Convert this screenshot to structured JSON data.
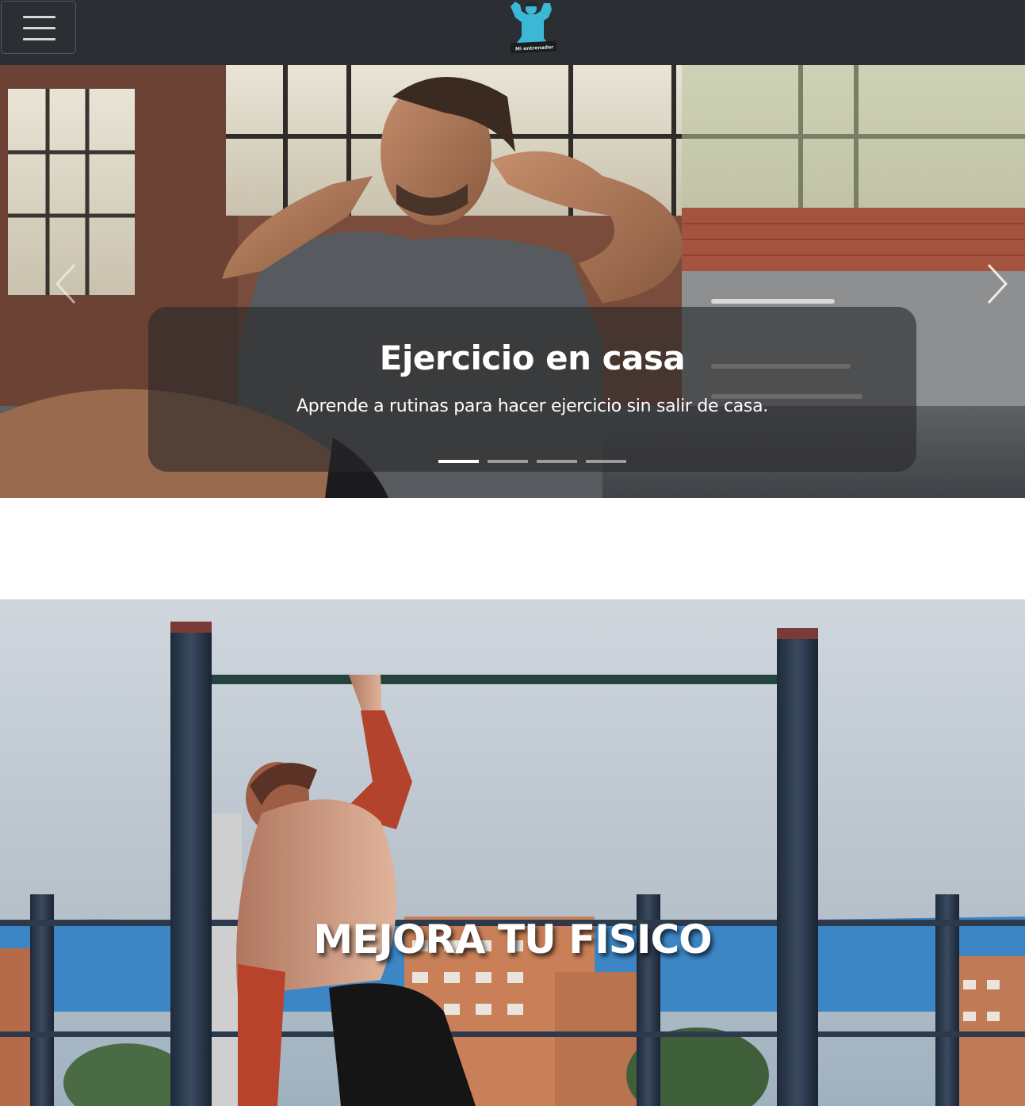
{
  "navbar": {
    "toggler_icon": "hamburger-menu-icon",
    "logo_icon": "flexing-man-logo",
    "logo_text": "Mi entrenador",
    "colors": {
      "background": "#2b2f33",
      "logo": "#3bb8d6"
    }
  },
  "carousel": {
    "slide_title": "Ejercicio en casa",
    "slide_text": "Aprende a rutinas para hacer ejercicio sin salir de casa.",
    "prev_icon": "chevron-left-icon",
    "next_icon": "chevron-right-icon",
    "slide_count": 4,
    "active_slide": 1,
    "image": "man-doing-situps-in-gym"
  },
  "hero": {
    "title": "MEJORA TU FISICO",
    "image": "man-doing-pullups-on-outdoor-bar"
  }
}
